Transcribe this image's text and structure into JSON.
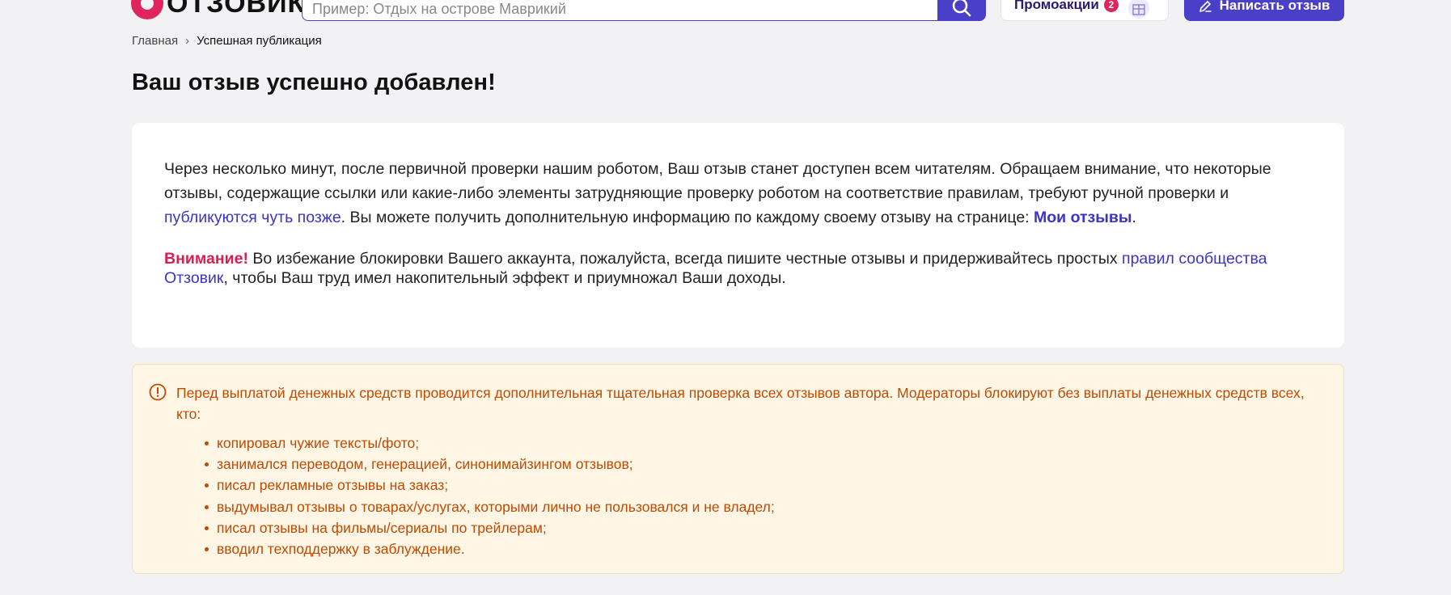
{
  "header": {
    "logo_text": "ОТЗОВИК",
    "search_placeholder": "Пример: Отдых на острове Маврикий",
    "promo_label": "Промоакции",
    "promo_count": "2",
    "write_label": "Написать отзыв"
  },
  "breadcrumb": {
    "home": "Главная",
    "separator": "›",
    "current": "Успешная публикация"
  },
  "title": "Ваш отзыв успешно добавлен!",
  "card": {
    "p1_part1": "Через несколько минут, после первичной проверки нашим роботом, Ваш отзыв станет доступен всем читателям. Обращаем внимание, что некоторые отзывы, содержащие ссылки или какие-либо элементы затрудняющие проверку роботом на соответствие правилам, требуют ручной проверки и ",
    "p1_link": "публикуются чуть позже",
    "p1_part2": ". Вы можете получить дополнительную информацию по каждому своему отзыву на странице: ",
    "p1_link2": "Мои отзывы",
    "p1_end": ".",
    "attention_label": "Внимание!",
    "p2_part1": " Во избежание блокировки Вашего аккаунта, пожалуйста, всегда пишите честные отзывы и придерживайтесь простых ",
    "p2_link": "правил сообщества Отзовик",
    "p2_part2": ", чтобы Ваш труд имел накопительный эффект и приумножал Ваши доходы."
  },
  "warning": {
    "text": "Перед выплатой денежных средств проводится дополнительная тщательная проверка всех отзывов автора. Модераторы блокируют без выплаты денежных средств всех, кто:",
    "items": [
      "копировал чужие тексты/фото;",
      "занимался переводом, генерацией, синонимайзингом отзывов;",
      "писал рекламные отзывы на заказ;",
      "выдумывал отзывы о товарах/услугах, которыми лично не пользовался и не владел;",
      "писал отзывы на фильмы/сериалы по трейлерам;",
      "вводил техподдержку в заблуждение."
    ]
  },
  "colors": {
    "brand": "#4a3fc9",
    "logo": "#e0245e",
    "attention": "#d6204e",
    "warning_text": "#c24a00",
    "warning_bg": "#fff6e5"
  }
}
